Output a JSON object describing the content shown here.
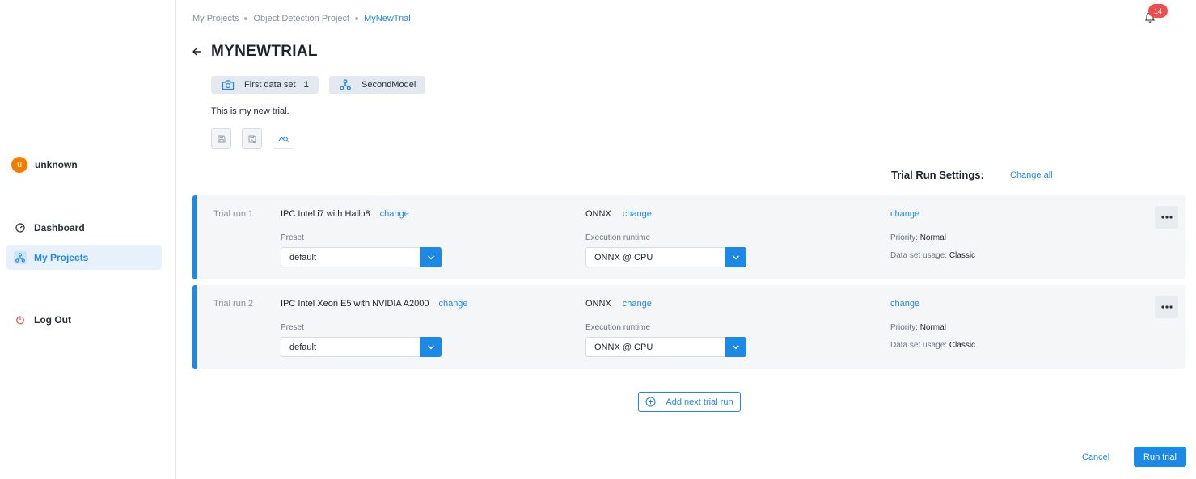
{
  "sidebar": {
    "user": {
      "initial": "u",
      "name": "unknown"
    },
    "nav": [
      {
        "label": "Dashboard",
        "icon": "dashboard-gauge-icon"
      },
      {
        "label": "My Projects",
        "icon": "projects-network-icon",
        "active": true
      },
      {
        "label": "Log Out",
        "icon": "power-icon"
      }
    ]
  },
  "breadcrumb": [
    "My Projects",
    "Object Detection Project",
    "MyNewTrial"
  ],
  "notifications": {
    "count": "14"
  },
  "page": {
    "title": "MYNEWTRIAL",
    "dataset_chip": {
      "label": "First data set",
      "count": "1"
    },
    "model_chip": {
      "label": "SecondModel"
    },
    "description": "This is my new trial."
  },
  "settings": {
    "title": "Trial Run Settings:",
    "change_all": "Change all"
  },
  "runs": [
    {
      "label": "Trial run 1",
      "device": "IPC Intel i7 with Hailo8",
      "device_change": "change",
      "format": "ONNX",
      "format_change": "change",
      "misc_change": "change",
      "preset_label": "Preset",
      "preset": "default",
      "runtime_label": "Execution runtime",
      "runtime": "ONNX @ CPU",
      "priority_label": "Priority:",
      "priority": "Normal",
      "usage_label": "Data set usage:",
      "usage": "Classic"
    },
    {
      "label": "Trial run 2",
      "device": "IPC Intel Xeon E5 with NVIDIA A2000",
      "device_change": "change",
      "format": "ONNX",
      "format_change": "change",
      "misc_change": "change",
      "preset_label": "Preset",
      "preset": "default",
      "runtime_label": "Execution runtime",
      "runtime": "ONNX @ CPU",
      "priority_label": "Priority:",
      "priority": "Normal",
      "usage_label": "Data set usage:",
      "usage": "Classic"
    }
  ],
  "actions": {
    "add_run": "Add next trial run",
    "cancel": "Cancel",
    "run_trial": "Run trial"
  },
  "colors": {
    "accent": "#1e88e5",
    "badge": "#ef4d4d",
    "avatar": "#f07c00"
  }
}
